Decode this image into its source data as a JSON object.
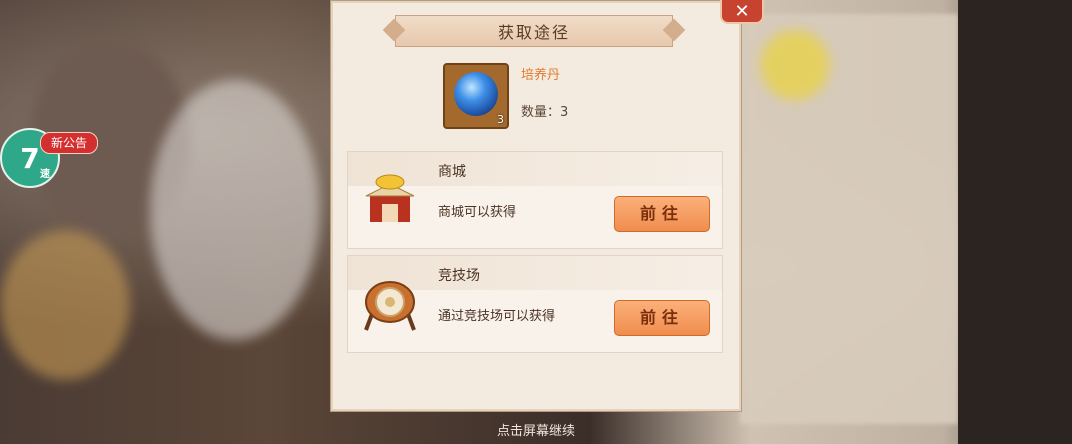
{
  "dialog": {
    "title": "获取途径",
    "item": {
      "name": "培养丹",
      "quantity_text": "数量：3",
      "count_badge": "3"
    },
    "sources": [
      {
        "name": "商城",
        "description": "商城可以获得",
        "button": "前往",
        "icon": "shop-icon"
      },
      {
        "name": "竞技场",
        "description": "通过竞技场可以获得",
        "button": "前往",
        "icon": "arena-drum-icon"
      }
    ],
    "close_icon": "close-icon"
  },
  "side": {
    "notice": "新公告",
    "speed_number": "7",
    "speed_label": "速"
  },
  "hint": "点击屏幕继续",
  "colors": {
    "accent": "#f08d4e",
    "item_name": "#e07b2f",
    "panel": "#f4ebe0"
  }
}
